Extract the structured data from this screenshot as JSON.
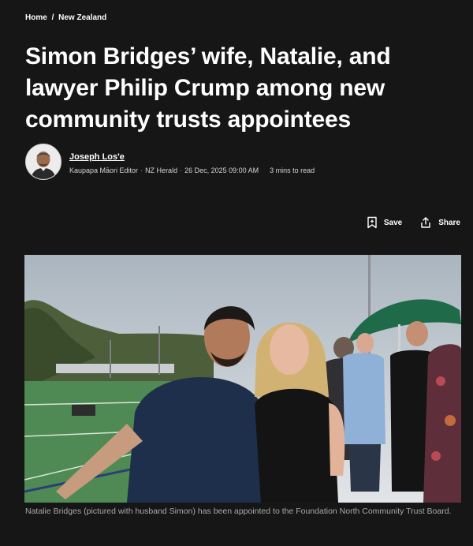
{
  "breadcrumb": {
    "home": "Home",
    "separator": "/",
    "section": "New Zealand"
  },
  "article": {
    "title": "Simon Bridges’ wife, Natalie, and lawyer Philip Crump among new community trusts appointees"
  },
  "author": {
    "name": "Joseph Los'e",
    "role": "Kaupapa Māori Editor",
    "outlet": "NZ Herald",
    "date": "26 Dec, 2025 09:00 AM",
    "read_time": "3 mins to read",
    "separator": "·"
  },
  "actions": {
    "save_label": "Save",
    "share_label": "Share",
    "save_icon": "bookmark-add-icon",
    "share_icon": "share-icon"
  },
  "image": {
    "caption": "Natalie Bridges (pictured with husband Simon) has been appointed to the Foundation North Community Trust Board."
  },
  "colors": {
    "background": "#161616",
    "text": "#ffffff",
    "caption": "#a9a9a9"
  }
}
